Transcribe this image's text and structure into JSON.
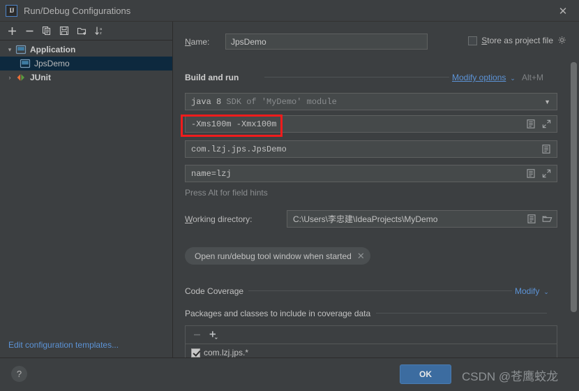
{
  "window": {
    "title": "Run/Debug Configurations",
    "logo_text": "IJ",
    "close_icon": "✕"
  },
  "sidebar": {
    "toolbar": [
      {
        "name": "add-button",
        "glyph": "＋"
      },
      {
        "name": "remove-button",
        "glyph": "－"
      },
      {
        "name": "copy-button",
        "glyph": "copy-icon"
      },
      {
        "name": "save-button",
        "glyph": "save-icon"
      },
      {
        "name": "new-folder-button",
        "glyph": "folder-add-icon"
      },
      {
        "name": "sort-button",
        "glyph": "sort-az-icon"
      }
    ],
    "tree": [
      {
        "label": "Application",
        "arrow": "▾",
        "icon": "application-icon",
        "level": 0,
        "selected": false,
        "bold": true
      },
      {
        "label": "JpsDemo",
        "arrow": "",
        "icon": "application-icon",
        "level": 1,
        "selected": true,
        "bold": false
      },
      {
        "label": "JUnit",
        "arrow": "›",
        "icon": "junit-icon",
        "level": 0,
        "selected": false,
        "bold": true
      }
    ],
    "edit_templates_link": "Edit configuration templates..."
  },
  "main": {
    "name_label": "Name:",
    "name_value": "JpsDemo",
    "store_as_project_file": {
      "label": "Store as project file",
      "checked": false,
      "gear_icon": "gear-icon"
    },
    "build_and_run": {
      "title": "Build and run",
      "modify_options_link": "Modify options",
      "modify_options_shortcut": "Alt+M",
      "jre_prefix": "java 8",
      "jre_suffix": "SDK of 'MyDemo' module",
      "vm_options_value": "-Xms100m -Xmx100m",
      "main_class_value": "com.lzj.jps.JpsDemo",
      "program_args_value": "name=lzj",
      "field_hint": "Press Alt for field hints",
      "working_dir_label": "Working directory:",
      "working_dir_value": "C:\\Users\\李忠建\\IdeaProjects\\MyDemo",
      "chip_label": "Open run/debug tool window when started"
    },
    "code_coverage": {
      "title": "Code Coverage",
      "modify_link": "Modify",
      "subtitle": "Packages and classes to include in coverage data",
      "remove_glyph": "−",
      "add_glyph": "+",
      "items": [
        {
          "label": "com.lzj.jps.*",
          "checked": true
        }
      ]
    }
  },
  "footer": {
    "help_label": "?",
    "ok_label": "OK",
    "watermark": "CSDN @苍鹰蛟龙"
  },
  "annotation": {
    "highlight_target": "vm-options-field",
    "highlight_color": "#f01c1c"
  }
}
